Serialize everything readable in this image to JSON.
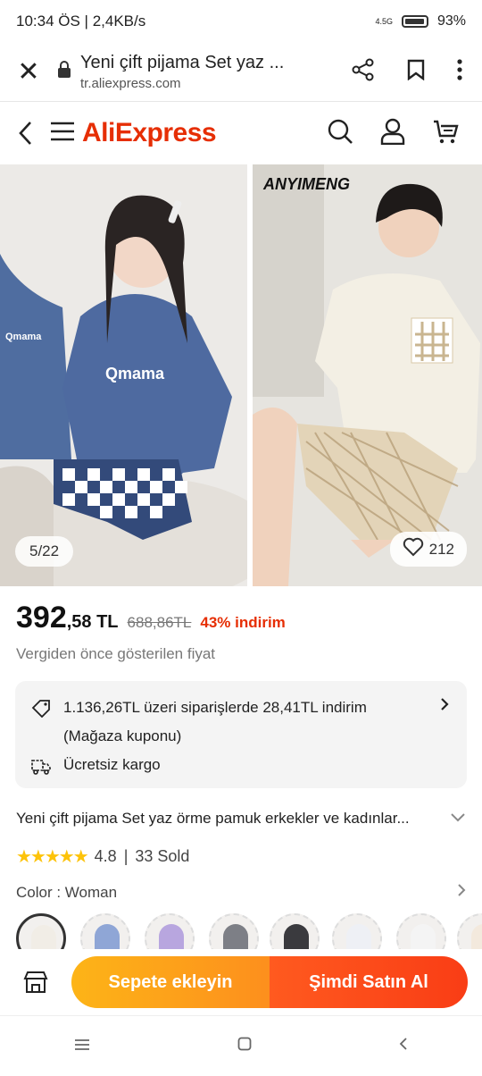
{
  "status": {
    "time_info": "10:34 ÖS | 2,4KB/s",
    "network": "4.5G",
    "battery": "93%"
  },
  "browser": {
    "page_title": "Yeni çift pijama Set yaz ...",
    "url": "tr.aliexpress.com"
  },
  "app": {
    "logo": "AliExpress",
    "brand_color": "#e62e04"
  },
  "gallery": {
    "counter": "5/22",
    "likes": "212",
    "brand_mark": "ANYIMENG"
  },
  "price": {
    "main": "392",
    "fraction": ",58 TL",
    "original": "688,86TL",
    "discount": "43% indirim",
    "note": "Vergiden önce gösterilen fiyat"
  },
  "coupon": {
    "offer": "1.136,26TL üzeri siparişlerde 28,41TL indirim",
    "offer_sub": "(Mağaza kuponu)",
    "shipping": "Ücretsiz kargo"
  },
  "product": {
    "title": "Yeni çift pijama Set yaz örme pamuk erkekler ve kadınlar...",
    "rating": "4.8",
    "sold": "33 Sold",
    "stars": 5
  },
  "variant": {
    "label": "Color",
    "value": "Woman"
  },
  "actions": {
    "add_to_cart": "Sepete ekleyin",
    "buy_now": "Şimdi Satın Al"
  },
  "icons": [
    "close-icon",
    "lock-icon",
    "share-icon",
    "bookmark-icon",
    "more-icon",
    "back-icon",
    "menu-icon",
    "search-icon",
    "user-icon",
    "cart-icon",
    "heart-icon",
    "coupon-icon",
    "truck-icon",
    "chevron-right-icon",
    "chevron-down-icon",
    "store-icon"
  ]
}
